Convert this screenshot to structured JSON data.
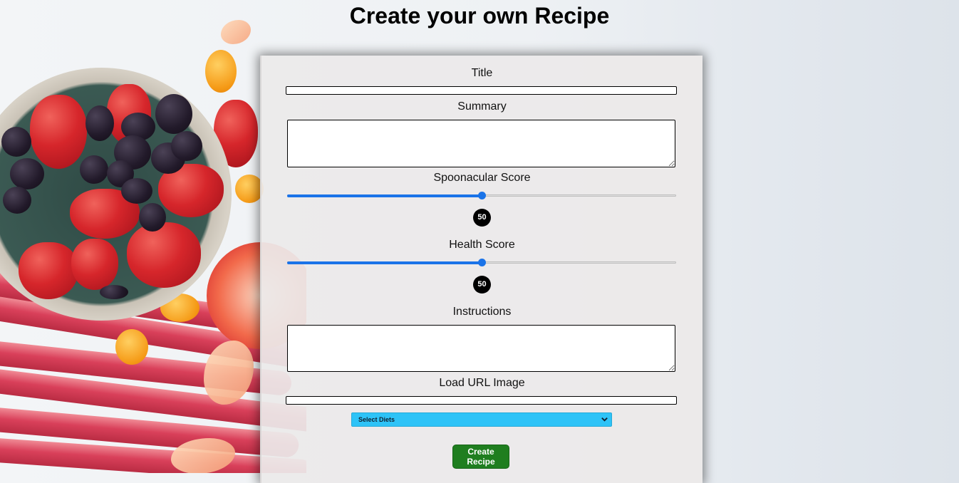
{
  "page": {
    "title": "Create your own Recipe"
  },
  "form": {
    "title_label": "Title",
    "title_value": "",
    "summary_label": "Summary",
    "summary_value": "",
    "spoonacular_label": "Spoonacular Score",
    "spoonacular_value": "50",
    "spoonacular_fraction": 0.5,
    "health_label": "Health Score",
    "health_value": "50",
    "health_fraction": 0.5,
    "instructions_label": "Instructions",
    "instructions_value": "",
    "image_label": "Load URL Image",
    "image_value": "",
    "diets_selected": "Select Diets",
    "submit_label": "Create Recipe"
  },
  "colors": {
    "slider_accent": "#1a73e8",
    "diets_select_bg": "#2ec3f7",
    "submit_bg": "#1f7e1f",
    "score_bubble_bg": "#000000"
  },
  "icons": {
    "diets_dropdown": "chevron-down-icon"
  }
}
